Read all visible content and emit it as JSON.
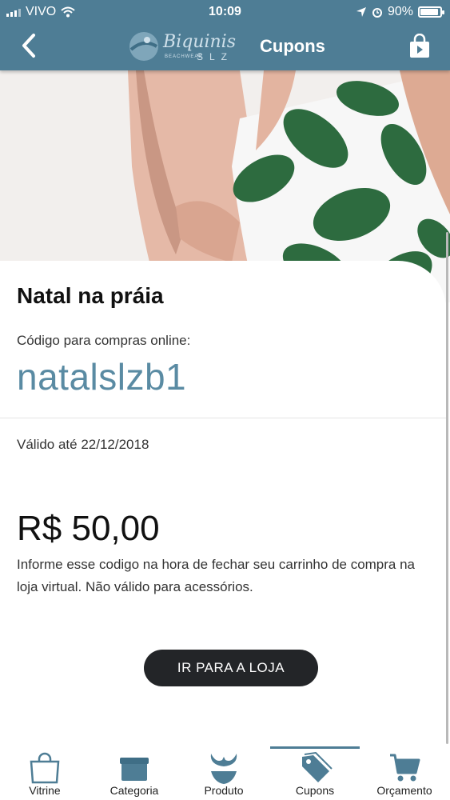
{
  "status_bar": {
    "carrier": "VIVO",
    "time": "10:09",
    "battery": "90%",
    "battery_level": 0.9
  },
  "header": {
    "brand": "Biquinis",
    "brand_sub": "SLZ",
    "brand_tagline": "BEACHWEAR",
    "title": "Cupons"
  },
  "coupon": {
    "name": "Natal na práia",
    "code_label": "Código para compras online:",
    "code": "natalslzb1",
    "valid_until": "Válido até 22/12/2018",
    "value": "R$ 50,00",
    "description": "Informe esse codigo na hora de fechar seu carrinho de compra na loja virtual. Não válido para acessórios.",
    "button_label": "IR PARA A LOJA"
  },
  "tabs": [
    {
      "label": "Vitrine",
      "icon": "shopping-bag-icon"
    },
    {
      "label": "Categoria",
      "icon": "box-icon"
    },
    {
      "label": "Produto",
      "icon": "bikini-icon"
    },
    {
      "label": "Cupons",
      "icon": "tag-icon",
      "active": true
    },
    {
      "label": "Orçamento",
      "icon": "cart-icon"
    }
  ],
  "colors": {
    "accent": "#4e7d95",
    "code": "#5a8ba3",
    "button": "#232528"
  }
}
